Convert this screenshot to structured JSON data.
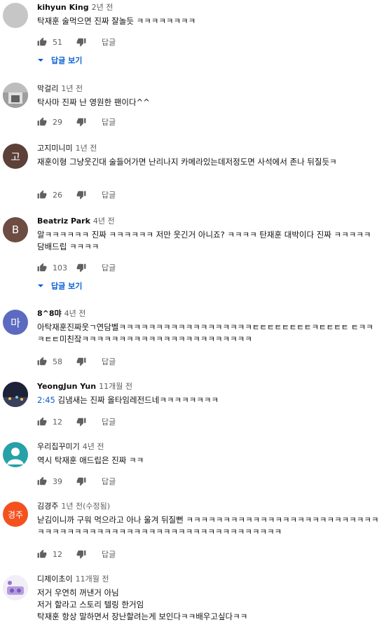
{
  "comments": [
    {
      "author": "kihyun King",
      "time": "2년 전",
      "text": "탁재훈 술먹으면 진짜 잘놀듯 ㅋㅋㅋㅋㅋㅋㅋㅋ",
      "likes": "51",
      "reply": "답글",
      "view_replies": "답글 보기",
      "avatar_color": "#c6c6c6",
      "avatar_text": ""
    },
    {
      "author": "막걸리",
      "time": "1년 전",
      "text": "탁사마 진짜 난 영원한 팬이다^^",
      "likes": "29",
      "reply": "답글",
      "avatar_color": "#8c8c8c",
      "avatar_text": ""
    },
    {
      "author": "고지미니미",
      "time": "1년 전",
      "text": "재훈이형 그냥웃긴대 술들어가면 난리나지 카메라있는데저정도면 사석에서 존나 뒤질듯ㅋ",
      "likes": "26",
      "reply": "답글",
      "avatar_color": "#5d4037",
      "avatar_text": "고"
    },
    {
      "author": "Beatriz Park",
      "time": "4년 전",
      "text": "알ㅋㅋㅋㅋㅋㅋ 진짜 ㅋㅋㅋㅋㅋㅋ 저만 웃긴거 아니죠? ㅋㅋㅋㅋ 탄재훈 대박이다 진짜 ㅋㅋㅋㅋㅋ 담배드립 ㅋㅋㅋㅋ",
      "likes": "103",
      "reply": "답글",
      "view_replies": "답글 보기",
      "avatar_color": "#6d4c41",
      "avatar_text": "B"
    },
    {
      "author": "8^8먀",
      "time": "4년 전",
      "text": "아탁재훈진짜웃ㄱ연담벨ㅋㅋㅋㅋㅋㅋㅋㅋㅋㅋㅋㅋㅋㅋㅋㅋㅋㅋㅌㅌㅌㅌㅌㅌㅌㅌㅋㅌㅌㅌㅌ ㅌㅋㅋㅋㅌㅌ미친잨ㅋㅋㅋㅋㅋㅋㅋㅋㅋㅋㅋㅋㅋㅋㅋㅋㅋㅋㅋㅋㅋㅋㅋ",
      "likes": "58",
      "reply": "답글",
      "avatar_color": "#5c6bc0",
      "avatar_text": "마"
    },
    {
      "author": "YeongJun Yun",
      "time": "11개월 전",
      "timestamp": "2:45",
      "text": " 김냄새는 진짜 올타임레전드네ㅋㅋㅋㅋㅋㅋㅋㅋ",
      "likes": "12",
      "reply": "답글",
      "avatar_color": "#2b2f45",
      "avatar_text": ""
    },
    {
      "author": "우리집꾸미기",
      "time": "4년 전",
      "text": "역시 탁재훈 애드립은 진짜 ㅋㅋ",
      "likes": "39",
      "reply": "답글",
      "avatar_color": "#26a1a8",
      "avatar_text": ""
    },
    {
      "author": "김경주",
      "time": "1년 전(수정됨)",
      "text": "낟김이니까 구워 먹으라고 아나 울겨 뒤질뻔 ㅋㅋㅋㅋㅋㅋㅋㅋㅋㅋㅋㅋㅋㅋㅋㅋㅋㅋㅋㅋㅋㅋㅋㅋㅋㅋㅋㅋㅋㅋㅋㅋㅋㅋㅋㅋㅋㅋㅋㅋㅋㅋㅋㅋㅋㅋㅋㅋㅋㅋㅋㅋㅋㅋㅋㅋㅋㅋㅋ",
      "likes": "12",
      "reply": "답글",
      "avatar_color": "#f4511e",
      "avatar_text": "경주"
    },
    {
      "author": "디제이초이",
      "time": "11개월 전",
      "text": "저거 우연히 꺼낸거 아님\n저거 할라고 스토리 텔링 한거임\n탁재훈 항상 말하면서 장난할려는게 보인다ㅋㅋ배우고싶다ㅋㅋ",
      "likes": "",
      "reply": "",
      "avatar_color": "#e8e0f0",
      "avatar_text": ""
    }
  ],
  "icons": {
    "like": "thumb-up-icon",
    "dislike": "thumb-down-icon",
    "expand": "chevron-down-icon"
  },
  "colors": {
    "link": "#065fd4",
    "secondary": "#606060"
  }
}
